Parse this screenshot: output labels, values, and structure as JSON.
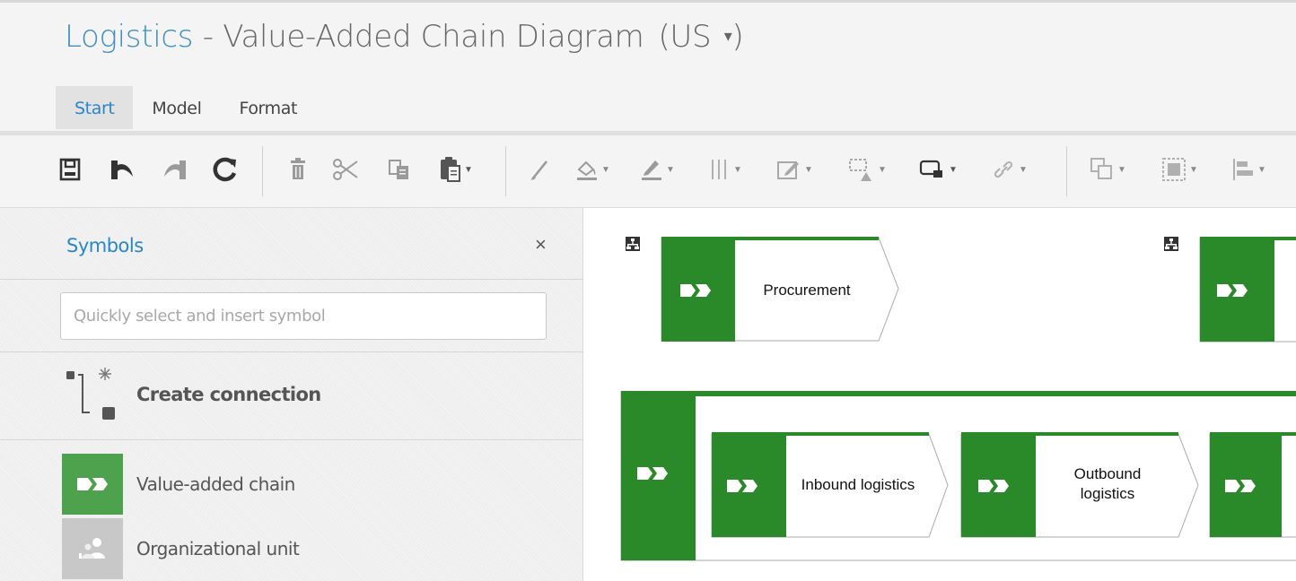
{
  "header": {
    "app_name": "Logistics",
    "separator": " - ",
    "document_title": "Value-Added Chain Diagram",
    "language": "(US",
    "language_caret": "▾",
    "language_close": ")"
  },
  "tabs": [
    {
      "label": "Start",
      "active": true
    },
    {
      "label": "Model",
      "active": false
    },
    {
      "label": "Format",
      "active": false
    }
  ],
  "toolbar": {
    "buttons": [
      "save-icon",
      "undo-icon",
      "redo-icon",
      "refresh-icon",
      "delete-icon",
      "cut-icon",
      "copy-icon",
      "paste-icon",
      "format-painter-icon",
      "fill-color-icon",
      "line-color-icon",
      "columns-icon",
      "edit-attributes-icon",
      "shape-icon",
      "connection-style-icon",
      "link-icon",
      "arrange-icon",
      "group-icon",
      "align-icon"
    ]
  },
  "sidebar": {
    "title": "Symbols",
    "close_label": "×",
    "search_placeholder": "Quickly select and insert symbol",
    "create_connection_label": "Create connection",
    "symbols": [
      {
        "label": "Value-added chain",
        "icon": "value-added-chain-icon",
        "color": "#4ea24d"
      },
      {
        "label": "Organizational unit",
        "icon": "organizational-unit-icon",
        "color": "#c8c8c8"
      }
    ]
  },
  "canvas": {
    "objects": [
      {
        "label": "Procurement"
      },
      {
        "label": "Inbound logistics"
      },
      {
        "label_line1": "Outbound",
        "label_line2": "logistics"
      }
    ]
  },
  "colors": {
    "accent_blue": "#2a86c6",
    "chain_green": "#2a8a2a",
    "toolbar_bg": "#f4f4f4"
  }
}
